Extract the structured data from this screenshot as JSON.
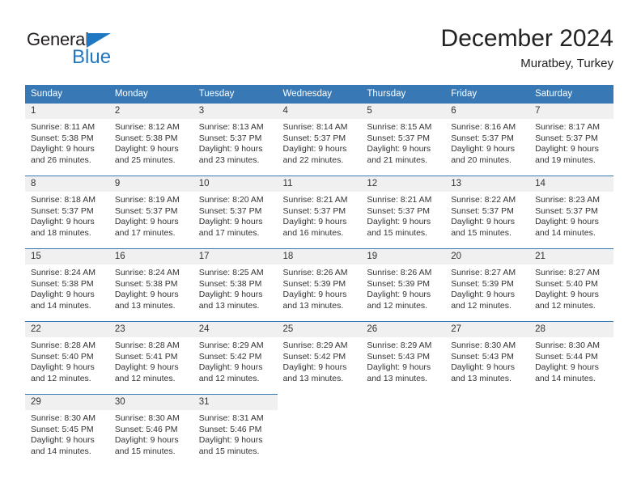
{
  "brand": {
    "name_part1": "General",
    "name_part2": "Blue",
    "accent_color": "#1f78c1"
  },
  "header": {
    "title": "December 2024",
    "subtitle": "Muratbey, Turkey"
  },
  "calendar": {
    "header_bg": "#3878b4",
    "daynum_bg": "#f0f0f0",
    "weekday_headers": [
      {
        "label": "Sunday"
      },
      {
        "label": "Monday"
      },
      {
        "label": "Tuesday"
      },
      {
        "label": "Wednesday"
      },
      {
        "label": "Thursday"
      },
      {
        "label": "Friday"
      },
      {
        "label": "Saturday"
      }
    ],
    "weeks": [
      {
        "days": [
          {
            "num": "1",
            "sunrise": "Sunrise: 8:11 AM",
            "sunset": "Sunset: 5:38 PM",
            "daylight1": "Daylight: 9 hours",
            "daylight2": "and 26 minutes."
          },
          {
            "num": "2",
            "sunrise": "Sunrise: 8:12 AM",
            "sunset": "Sunset: 5:38 PM",
            "daylight1": "Daylight: 9 hours",
            "daylight2": "and 25 minutes."
          },
          {
            "num": "3",
            "sunrise": "Sunrise: 8:13 AM",
            "sunset": "Sunset: 5:37 PM",
            "daylight1": "Daylight: 9 hours",
            "daylight2": "and 23 minutes."
          },
          {
            "num": "4",
            "sunrise": "Sunrise: 8:14 AM",
            "sunset": "Sunset: 5:37 PM",
            "daylight1": "Daylight: 9 hours",
            "daylight2": "and 22 minutes."
          },
          {
            "num": "5",
            "sunrise": "Sunrise: 8:15 AM",
            "sunset": "Sunset: 5:37 PM",
            "daylight1": "Daylight: 9 hours",
            "daylight2": "and 21 minutes."
          },
          {
            "num": "6",
            "sunrise": "Sunrise: 8:16 AM",
            "sunset": "Sunset: 5:37 PM",
            "daylight1": "Daylight: 9 hours",
            "daylight2": "and 20 minutes."
          },
          {
            "num": "7",
            "sunrise": "Sunrise: 8:17 AM",
            "sunset": "Sunset: 5:37 PM",
            "daylight1": "Daylight: 9 hours",
            "daylight2": "and 19 minutes."
          }
        ]
      },
      {
        "days": [
          {
            "num": "8",
            "sunrise": "Sunrise: 8:18 AM",
            "sunset": "Sunset: 5:37 PM",
            "daylight1": "Daylight: 9 hours",
            "daylight2": "and 18 minutes."
          },
          {
            "num": "9",
            "sunrise": "Sunrise: 8:19 AM",
            "sunset": "Sunset: 5:37 PM",
            "daylight1": "Daylight: 9 hours",
            "daylight2": "and 17 minutes."
          },
          {
            "num": "10",
            "sunrise": "Sunrise: 8:20 AM",
            "sunset": "Sunset: 5:37 PM",
            "daylight1": "Daylight: 9 hours",
            "daylight2": "and 17 minutes."
          },
          {
            "num": "11",
            "sunrise": "Sunrise: 8:21 AM",
            "sunset": "Sunset: 5:37 PM",
            "daylight1": "Daylight: 9 hours",
            "daylight2": "and 16 minutes."
          },
          {
            "num": "12",
            "sunrise": "Sunrise: 8:21 AM",
            "sunset": "Sunset: 5:37 PM",
            "daylight1": "Daylight: 9 hours",
            "daylight2": "and 15 minutes."
          },
          {
            "num": "13",
            "sunrise": "Sunrise: 8:22 AM",
            "sunset": "Sunset: 5:37 PM",
            "daylight1": "Daylight: 9 hours",
            "daylight2": "and 15 minutes."
          },
          {
            "num": "14",
            "sunrise": "Sunrise: 8:23 AM",
            "sunset": "Sunset: 5:37 PM",
            "daylight1": "Daylight: 9 hours",
            "daylight2": "and 14 minutes."
          }
        ]
      },
      {
        "days": [
          {
            "num": "15",
            "sunrise": "Sunrise: 8:24 AM",
            "sunset": "Sunset: 5:38 PM",
            "daylight1": "Daylight: 9 hours",
            "daylight2": "and 14 minutes."
          },
          {
            "num": "16",
            "sunrise": "Sunrise: 8:24 AM",
            "sunset": "Sunset: 5:38 PM",
            "daylight1": "Daylight: 9 hours",
            "daylight2": "and 13 minutes."
          },
          {
            "num": "17",
            "sunrise": "Sunrise: 8:25 AM",
            "sunset": "Sunset: 5:38 PM",
            "daylight1": "Daylight: 9 hours",
            "daylight2": "and 13 minutes."
          },
          {
            "num": "18",
            "sunrise": "Sunrise: 8:26 AM",
            "sunset": "Sunset: 5:39 PM",
            "daylight1": "Daylight: 9 hours",
            "daylight2": "and 13 minutes."
          },
          {
            "num": "19",
            "sunrise": "Sunrise: 8:26 AM",
            "sunset": "Sunset: 5:39 PM",
            "daylight1": "Daylight: 9 hours",
            "daylight2": "and 12 minutes."
          },
          {
            "num": "20",
            "sunrise": "Sunrise: 8:27 AM",
            "sunset": "Sunset: 5:39 PM",
            "daylight1": "Daylight: 9 hours",
            "daylight2": "and 12 minutes."
          },
          {
            "num": "21",
            "sunrise": "Sunrise: 8:27 AM",
            "sunset": "Sunset: 5:40 PM",
            "daylight1": "Daylight: 9 hours",
            "daylight2": "and 12 minutes."
          }
        ]
      },
      {
        "days": [
          {
            "num": "22",
            "sunrise": "Sunrise: 8:28 AM",
            "sunset": "Sunset: 5:40 PM",
            "daylight1": "Daylight: 9 hours",
            "daylight2": "and 12 minutes."
          },
          {
            "num": "23",
            "sunrise": "Sunrise: 8:28 AM",
            "sunset": "Sunset: 5:41 PM",
            "daylight1": "Daylight: 9 hours",
            "daylight2": "and 12 minutes."
          },
          {
            "num": "24",
            "sunrise": "Sunrise: 8:29 AM",
            "sunset": "Sunset: 5:42 PM",
            "daylight1": "Daylight: 9 hours",
            "daylight2": "and 12 minutes."
          },
          {
            "num": "25",
            "sunrise": "Sunrise: 8:29 AM",
            "sunset": "Sunset: 5:42 PM",
            "daylight1": "Daylight: 9 hours",
            "daylight2": "and 13 minutes."
          },
          {
            "num": "26",
            "sunrise": "Sunrise: 8:29 AM",
            "sunset": "Sunset: 5:43 PM",
            "daylight1": "Daylight: 9 hours",
            "daylight2": "and 13 minutes."
          },
          {
            "num": "27",
            "sunrise": "Sunrise: 8:30 AM",
            "sunset": "Sunset: 5:43 PM",
            "daylight1": "Daylight: 9 hours",
            "daylight2": "and 13 minutes."
          },
          {
            "num": "28",
            "sunrise": "Sunrise: 8:30 AM",
            "sunset": "Sunset: 5:44 PM",
            "daylight1": "Daylight: 9 hours",
            "daylight2": "and 14 minutes."
          }
        ]
      },
      {
        "days": [
          {
            "num": "29",
            "sunrise": "Sunrise: 8:30 AM",
            "sunset": "Sunset: 5:45 PM",
            "daylight1": "Daylight: 9 hours",
            "daylight2": "and 14 minutes."
          },
          {
            "num": "30",
            "sunrise": "Sunrise: 8:30 AM",
            "sunset": "Sunset: 5:46 PM",
            "daylight1": "Daylight: 9 hours",
            "daylight2": "and 15 minutes."
          },
          {
            "num": "31",
            "sunrise": "Sunrise: 8:31 AM",
            "sunset": "Sunset: 5:46 PM",
            "daylight1": "Daylight: 9 hours",
            "daylight2": "and 15 minutes."
          },
          {
            "num": "",
            "sunrise": "",
            "sunset": "",
            "daylight1": "",
            "daylight2": ""
          },
          {
            "num": "",
            "sunrise": "",
            "sunset": "",
            "daylight1": "",
            "daylight2": ""
          },
          {
            "num": "",
            "sunrise": "",
            "sunset": "",
            "daylight1": "",
            "daylight2": ""
          },
          {
            "num": "",
            "sunrise": "",
            "sunset": "",
            "daylight1": "",
            "daylight2": ""
          }
        ]
      }
    ]
  }
}
